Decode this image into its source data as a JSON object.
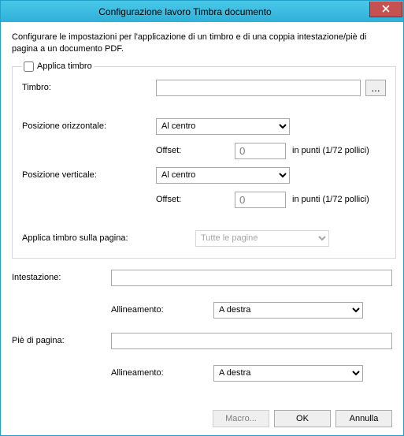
{
  "window": {
    "title": "Configurazione lavoro Timbra documento"
  },
  "description": "Configurare le impostazioni per l'applicazione di un timbro e di una coppia intestazione/piè di pagina a un documento PDF.",
  "stamp_group": {
    "checkbox_label": "Applica timbro",
    "checked": false,
    "stamp_label": "Timbro:",
    "stamp_value": "",
    "browse_label": "...",
    "hpos_label": "Posizione orizzontale:",
    "hpos_value": "Al centro",
    "vpos_label": "Posizione verticale:",
    "vpos_value": "Al centro",
    "offset_label": "Offset:",
    "offset_h_value": "0",
    "offset_v_value": "0",
    "offset_unit": "in punti (1/72 pollici)",
    "page_label": "Applica timbro sulla pagina:",
    "page_value": "Tutte le pagine"
  },
  "header": {
    "label": "Intestazione:",
    "value": "",
    "align_label": "Allineamento:",
    "align_value": "A destra"
  },
  "footer": {
    "label": "Piè di pagina:",
    "value": "",
    "align_label": "Allineamento:",
    "align_value": "A destra"
  },
  "buttons": {
    "macro": "Macro...",
    "ok": "OK",
    "cancel": "Annulla"
  }
}
